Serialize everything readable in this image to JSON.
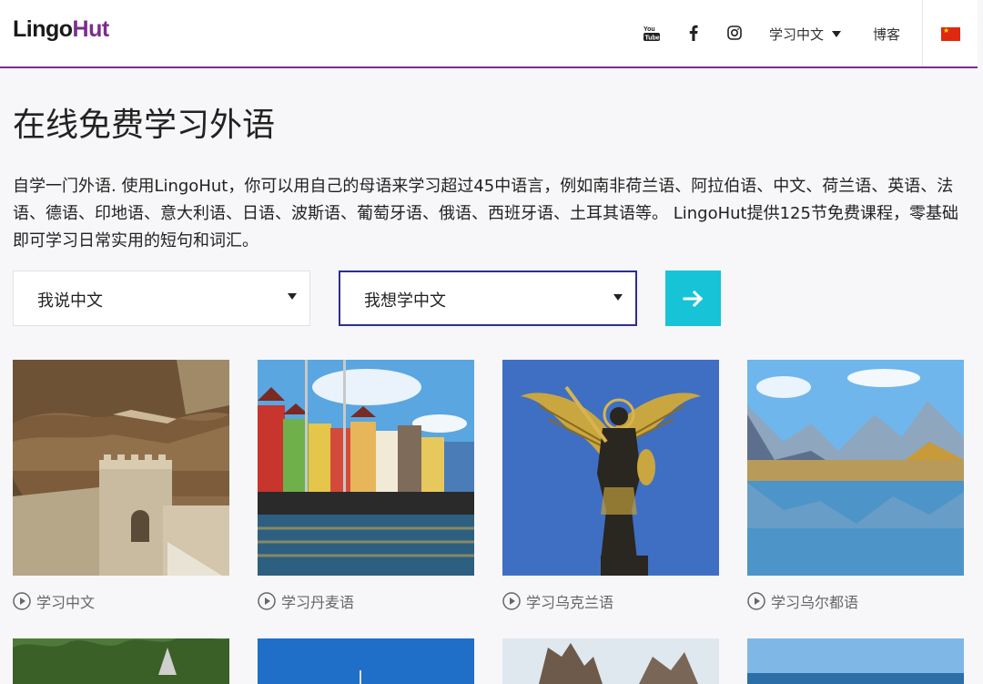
{
  "header": {
    "logo_part1": "Lingo",
    "logo_part2": "Hut",
    "nav": {
      "youtube_icon": "youtube-icon",
      "facebook_icon": "facebook-icon",
      "instagram_icon": "instagram-icon",
      "learn_menu_label": "学习中文",
      "blog_label": "博客",
      "language_flag": "china-flag-icon"
    },
    "accent_color": "#7b2d8e"
  },
  "main": {
    "title": "在线免费学习外语",
    "intro": "自学一门外语. 使用LingoHut，你可以用自己的母语来学习超过45中语言，例如南非荷兰语、阿拉伯语、中文、荷兰语、英语、法语、德语、印地语、意大利语、日语、波斯语、葡萄牙语、俄语、西班牙语、土耳其语等。 LingoHut提供125节免费课程，零基础即可学习日常实用的短句和词汇。",
    "native_select": "我说中文",
    "target_select": "我想学中文",
    "go_button_icon": "arrow-right-icon",
    "go_button_color": "#17c3d6"
  },
  "cards": [
    {
      "label": "学习中文",
      "image": "great-wall"
    },
    {
      "label": "学习丹麦语",
      "image": "copenhagen-harbor"
    },
    {
      "label": "学习乌克兰语",
      "image": "archangel-statue"
    },
    {
      "label": "学习乌尔都语",
      "image": "mountain-lake"
    }
  ]
}
